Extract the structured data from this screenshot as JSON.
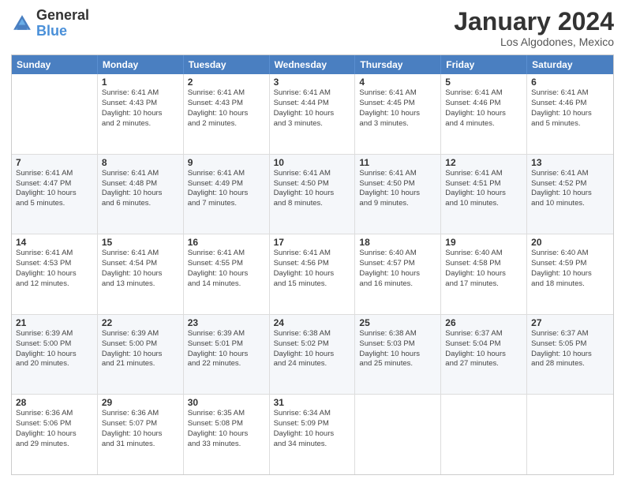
{
  "header": {
    "logo_line1": "General",
    "logo_line2": "Blue",
    "main_title": "January 2024",
    "subtitle": "Los Algodones, Mexico"
  },
  "days_of_week": [
    "Sunday",
    "Monday",
    "Tuesday",
    "Wednesday",
    "Thursday",
    "Friday",
    "Saturday"
  ],
  "weeks": [
    [
      {
        "day": "",
        "info": ""
      },
      {
        "day": "1",
        "info": "Sunrise: 6:41 AM\nSunset: 4:43 PM\nDaylight: 10 hours\nand 2 minutes."
      },
      {
        "day": "2",
        "info": "Sunrise: 6:41 AM\nSunset: 4:43 PM\nDaylight: 10 hours\nand 2 minutes."
      },
      {
        "day": "3",
        "info": "Sunrise: 6:41 AM\nSunset: 4:44 PM\nDaylight: 10 hours\nand 3 minutes."
      },
      {
        "day": "4",
        "info": "Sunrise: 6:41 AM\nSunset: 4:45 PM\nDaylight: 10 hours\nand 3 minutes."
      },
      {
        "day": "5",
        "info": "Sunrise: 6:41 AM\nSunset: 4:46 PM\nDaylight: 10 hours\nand 4 minutes."
      },
      {
        "day": "6",
        "info": "Sunrise: 6:41 AM\nSunset: 4:46 PM\nDaylight: 10 hours\nand 5 minutes."
      }
    ],
    [
      {
        "day": "7",
        "info": "Sunrise: 6:41 AM\nSunset: 4:47 PM\nDaylight: 10 hours\nand 5 minutes."
      },
      {
        "day": "8",
        "info": "Sunrise: 6:41 AM\nSunset: 4:48 PM\nDaylight: 10 hours\nand 6 minutes."
      },
      {
        "day": "9",
        "info": "Sunrise: 6:41 AM\nSunset: 4:49 PM\nDaylight: 10 hours\nand 7 minutes."
      },
      {
        "day": "10",
        "info": "Sunrise: 6:41 AM\nSunset: 4:50 PM\nDaylight: 10 hours\nand 8 minutes."
      },
      {
        "day": "11",
        "info": "Sunrise: 6:41 AM\nSunset: 4:50 PM\nDaylight: 10 hours\nand 9 minutes."
      },
      {
        "day": "12",
        "info": "Sunrise: 6:41 AM\nSunset: 4:51 PM\nDaylight: 10 hours\nand 10 minutes."
      },
      {
        "day": "13",
        "info": "Sunrise: 6:41 AM\nSunset: 4:52 PM\nDaylight: 10 hours\nand 10 minutes."
      }
    ],
    [
      {
        "day": "14",
        "info": "Sunrise: 6:41 AM\nSunset: 4:53 PM\nDaylight: 10 hours\nand 12 minutes."
      },
      {
        "day": "15",
        "info": "Sunrise: 6:41 AM\nSunset: 4:54 PM\nDaylight: 10 hours\nand 13 minutes."
      },
      {
        "day": "16",
        "info": "Sunrise: 6:41 AM\nSunset: 4:55 PM\nDaylight: 10 hours\nand 14 minutes."
      },
      {
        "day": "17",
        "info": "Sunrise: 6:41 AM\nSunset: 4:56 PM\nDaylight: 10 hours\nand 15 minutes."
      },
      {
        "day": "18",
        "info": "Sunrise: 6:40 AM\nSunset: 4:57 PM\nDaylight: 10 hours\nand 16 minutes."
      },
      {
        "day": "19",
        "info": "Sunrise: 6:40 AM\nSunset: 4:58 PM\nDaylight: 10 hours\nand 17 minutes."
      },
      {
        "day": "20",
        "info": "Sunrise: 6:40 AM\nSunset: 4:59 PM\nDaylight: 10 hours\nand 18 minutes."
      }
    ],
    [
      {
        "day": "21",
        "info": "Sunrise: 6:39 AM\nSunset: 5:00 PM\nDaylight: 10 hours\nand 20 minutes."
      },
      {
        "day": "22",
        "info": "Sunrise: 6:39 AM\nSunset: 5:00 PM\nDaylight: 10 hours\nand 21 minutes."
      },
      {
        "day": "23",
        "info": "Sunrise: 6:39 AM\nSunset: 5:01 PM\nDaylight: 10 hours\nand 22 minutes."
      },
      {
        "day": "24",
        "info": "Sunrise: 6:38 AM\nSunset: 5:02 PM\nDaylight: 10 hours\nand 24 minutes."
      },
      {
        "day": "25",
        "info": "Sunrise: 6:38 AM\nSunset: 5:03 PM\nDaylight: 10 hours\nand 25 minutes."
      },
      {
        "day": "26",
        "info": "Sunrise: 6:37 AM\nSunset: 5:04 PM\nDaylight: 10 hours\nand 27 minutes."
      },
      {
        "day": "27",
        "info": "Sunrise: 6:37 AM\nSunset: 5:05 PM\nDaylight: 10 hours\nand 28 minutes."
      }
    ],
    [
      {
        "day": "28",
        "info": "Sunrise: 6:36 AM\nSunset: 5:06 PM\nDaylight: 10 hours\nand 29 minutes."
      },
      {
        "day": "29",
        "info": "Sunrise: 6:36 AM\nSunset: 5:07 PM\nDaylight: 10 hours\nand 31 minutes."
      },
      {
        "day": "30",
        "info": "Sunrise: 6:35 AM\nSunset: 5:08 PM\nDaylight: 10 hours\nand 33 minutes."
      },
      {
        "day": "31",
        "info": "Sunrise: 6:34 AM\nSunset: 5:09 PM\nDaylight: 10 hours\nand 34 minutes."
      },
      {
        "day": "",
        "info": ""
      },
      {
        "day": "",
        "info": ""
      },
      {
        "day": "",
        "info": ""
      }
    ]
  ]
}
